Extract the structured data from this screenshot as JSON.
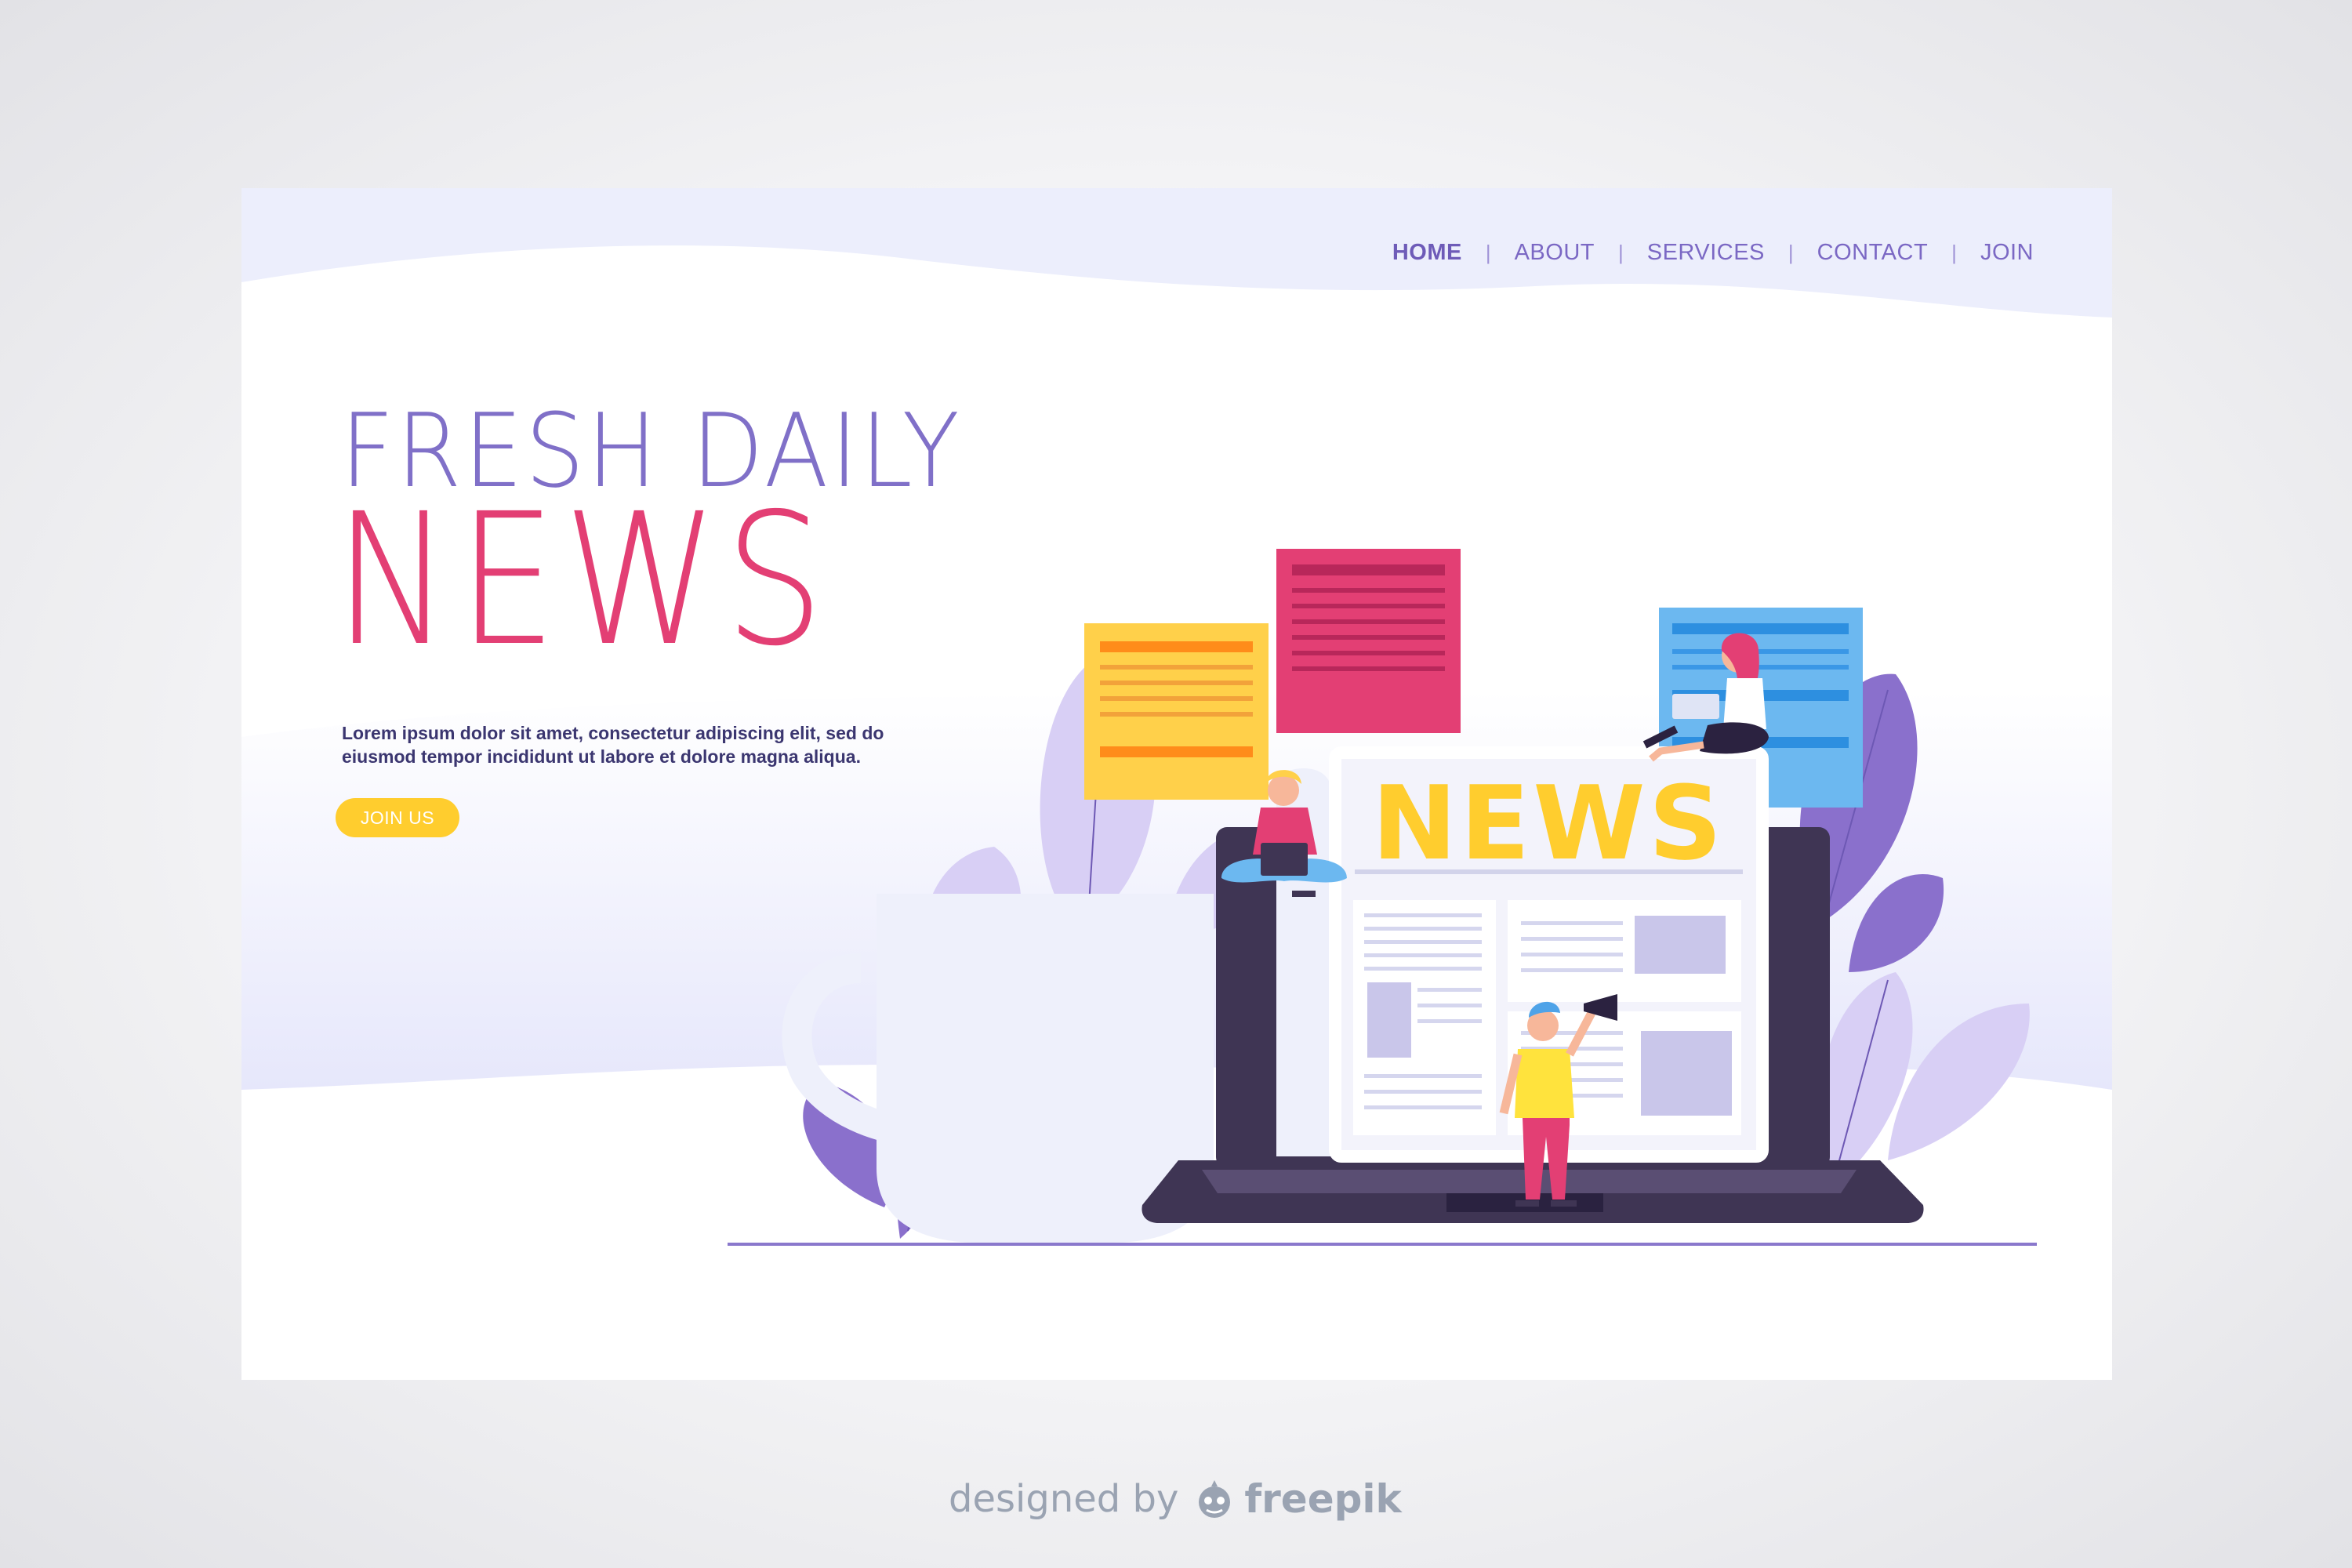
{
  "nav": {
    "items": [
      {
        "label": "HOME",
        "active": true
      },
      {
        "label": "ABOUT",
        "active": false
      },
      {
        "label": "SERVICES",
        "active": false
      },
      {
        "label": "CONTACT",
        "active": false
      },
      {
        "label": "JOIN",
        "active": false
      }
    ],
    "separator": "|"
  },
  "hero": {
    "subtitle": "FRESH DAILY",
    "title": "NEWS",
    "body": "Lorem ipsum dolor sit amet, consectetur adipiscing elit, sed do eiusmod tempor incididunt ut labore et dolore magna aliqua.",
    "cta_label": "JOIN US"
  },
  "illustration": {
    "newspaper_headline": "NEWS"
  },
  "credit": {
    "prefix": "designed by",
    "brand": "freepik"
  },
  "colors": {
    "accent_pink": "#e33f74",
    "accent_purple": "#7b68c4",
    "accent_yellow": "#ffcd2e",
    "laptop_dark": "#3f3554"
  }
}
